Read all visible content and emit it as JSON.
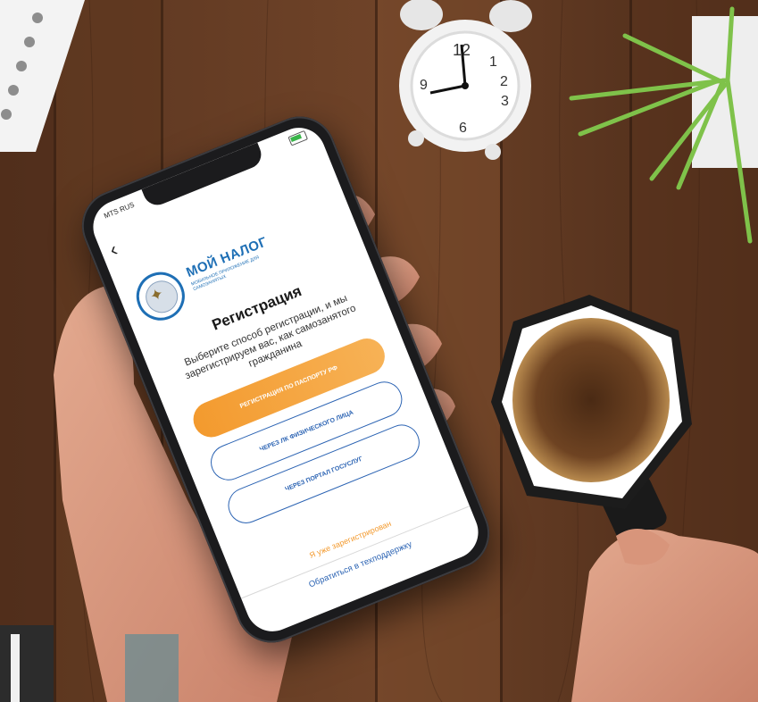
{
  "status_bar": {
    "carrier": "MTS RUS"
  },
  "app": {
    "brand": "МОЙ НАЛОГ",
    "brand_subtitle": "МОБИЛЬНОЕ ПРИЛОЖЕНИЕ ДЛЯ САМОЗАНЯТЫХ",
    "title": "Регистрация",
    "description": "Выберите способ регистрации, и мы зарегистрируем вас, как самозанятого гражданина",
    "buttons": [
      {
        "label": "Регистрация по паспорту РФ"
      },
      {
        "label": "Через ЛК физического лица"
      },
      {
        "label": "Через портал Госуслуг"
      }
    ],
    "already_registered": "Я уже зарегистрирован",
    "support_link": "Обратиться в техподдержку"
  },
  "clock": {
    "numbers": [
      "12",
      "1",
      "2",
      "3",
      "6",
      "9"
    ]
  },
  "colors": {
    "wood_dark": "#4a2c1c",
    "wood_mid": "#6b4127",
    "accent_orange": "#f39a2e",
    "brand_blue": "#1e6fb5",
    "coffee": "#6e4322"
  }
}
